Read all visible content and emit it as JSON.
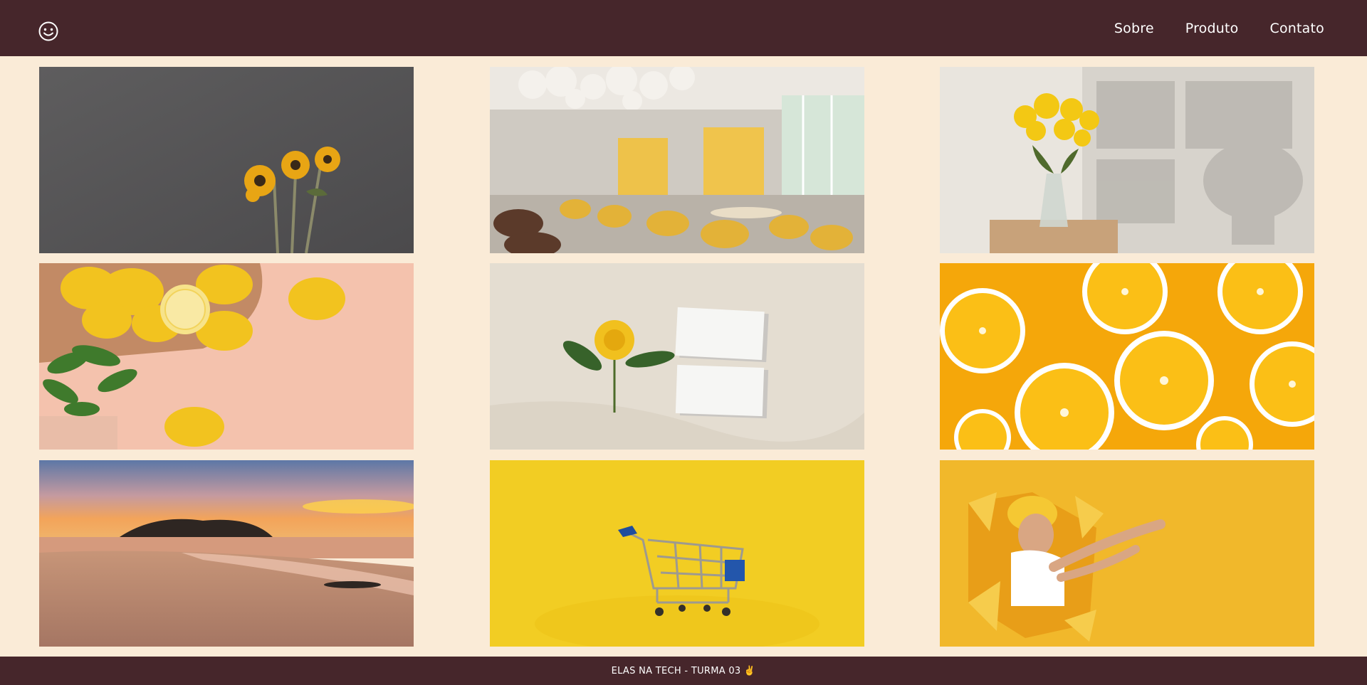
{
  "header": {
    "logo_icon": "smiley-face-icon",
    "nav": [
      {
        "label": "Sobre"
      },
      {
        "label": "Produto"
      },
      {
        "label": "Contato"
      }
    ]
  },
  "gallery": {
    "images": [
      {
        "subject": "sunflowers",
        "icon": "sunflowers-photo"
      },
      {
        "subject": "restaurant interior",
        "icon": "restaurant-photo"
      },
      {
        "subject": "yellow flowers in vase",
        "icon": "flower-vase-photo"
      },
      {
        "subject": "lemons on pink background",
        "icon": "lemons-photo"
      },
      {
        "subject": "flower and business cards",
        "icon": "cards-flower-photo"
      },
      {
        "subject": "orange slices",
        "icon": "orange-slices-photo"
      },
      {
        "subject": "beach sunset",
        "icon": "beach-sunset-photo"
      },
      {
        "subject": "shopping cart on yellow",
        "icon": "shopping-cart-photo"
      },
      {
        "subject": "man pointing through paper",
        "icon": "man-pointing-photo"
      }
    ]
  },
  "footer": {
    "text": "ELAS NA TECH - TURMA 03 ✌️"
  },
  "colors": {
    "header_bg": "#46262b",
    "page_bg": "#faebd7",
    "accent_yellow": "#f2c21b"
  }
}
